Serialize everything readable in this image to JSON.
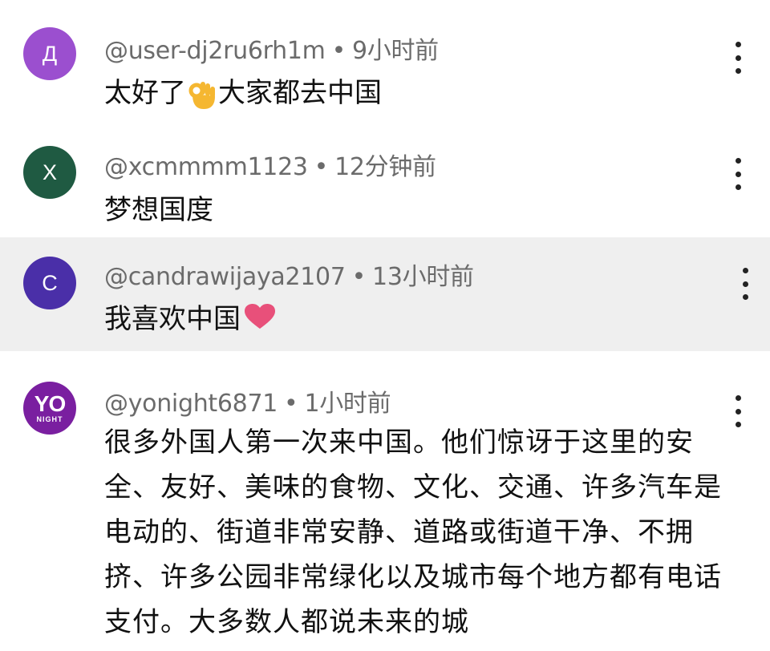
{
  "comments": [
    {
      "avatar_letter": "Д",
      "avatar_color": "#9b4fcf",
      "username": "@user-dj2ru6rh1m",
      "time": "9小时前",
      "text_before": "太好了",
      "emoji": "ok-hand",
      "text_after": "大家都去中国"
    },
    {
      "avatar_letter": "X",
      "avatar_color": "#1f5a42",
      "username": "@xcmmmm1123",
      "time": "12分钟前",
      "text": "梦想国度"
    },
    {
      "avatar_letter": "C",
      "avatar_color": "#4a2fa8",
      "username": "@candrawijaya2107",
      "time": "13小时前",
      "text": "我喜欢中国",
      "emoji": "heart"
    },
    {
      "avatar_text_big": "YO",
      "avatar_text_small": "NIGHT",
      "avatar_color": "#7a1fa0",
      "username": "@yonight6871",
      "time": "1小时前",
      "text": "很多外国人第一次来中国。他们惊讶于这里的安全、友好、美味的食物、文化、交通、许多汽车是电动的、街道非常安静、道路或街道干净、不拥挤、许多公园非常绿化以及城市每个地方都有电话支付。大多数人都说未来的城"
    }
  ],
  "separator": "•",
  "colors": {
    "highlight_row": "#efefef",
    "meta_text": "#6b6b6b",
    "body_text": "#111111",
    "heart": "#e8507a",
    "ok_hand": "#f5b731"
  }
}
